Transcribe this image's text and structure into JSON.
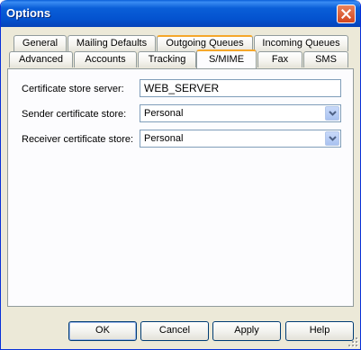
{
  "window": {
    "title": "Options"
  },
  "tabs_back": [
    {
      "id": "general",
      "label": "General"
    },
    {
      "id": "mailing-defaults",
      "label": "Mailing Defaults"
    },
    {
      "id": "outgoing-queues",
      "label": "Outgoing Queues"
    },
    {
      "id": "incoming-queues",
      "label": "Incoming Queues"
    }
  ],
  "tabs_front": [
    {
      "id": "advanced",
      "label": "Advanced"
    },
    {
      "id": "accounts",
      "label": "Accounts"
    },
    {
      "id": "tracking",
      "label": "Tracking"
    },
    {
      "id": "smime",
      "label": "S/MIME"
    },
    {
      "id": "fax",
      "label": "Fax"
    },
    {
      "id": "sms",
      "label": "SMS"
    }
  ],
  "active_tab": "S/MIME",
  "form": {
    "cert_store_server_label": "Certificate store server:",
    "cert_store_server_value": "WEB_SERVER",
    "sender_cert_store_label": "Sender certificate store:",
    "sender_cert_store_value": "Personal",
    "receiver_cert_store_label": "Receiver certificate store:",
    "receiver_cert_store_value": "Personal"
  },
  "buttons": {
    "ok": "OK",
    "cancel": "Cancel",
    "apply": "Apply",
    "help": "Help"
  },
  "colors": {
    "titlebar": "#0a5fd8",
    "dialog_bg": "#ece9d8",
    "active_tab_accent": "#f5a72a",
    "close_button": "#d2461f"
  },
  "icons": [
    "close-icon",
    "dropdown-arrow-icon",
    "size-grip-icon"
  ]
}
